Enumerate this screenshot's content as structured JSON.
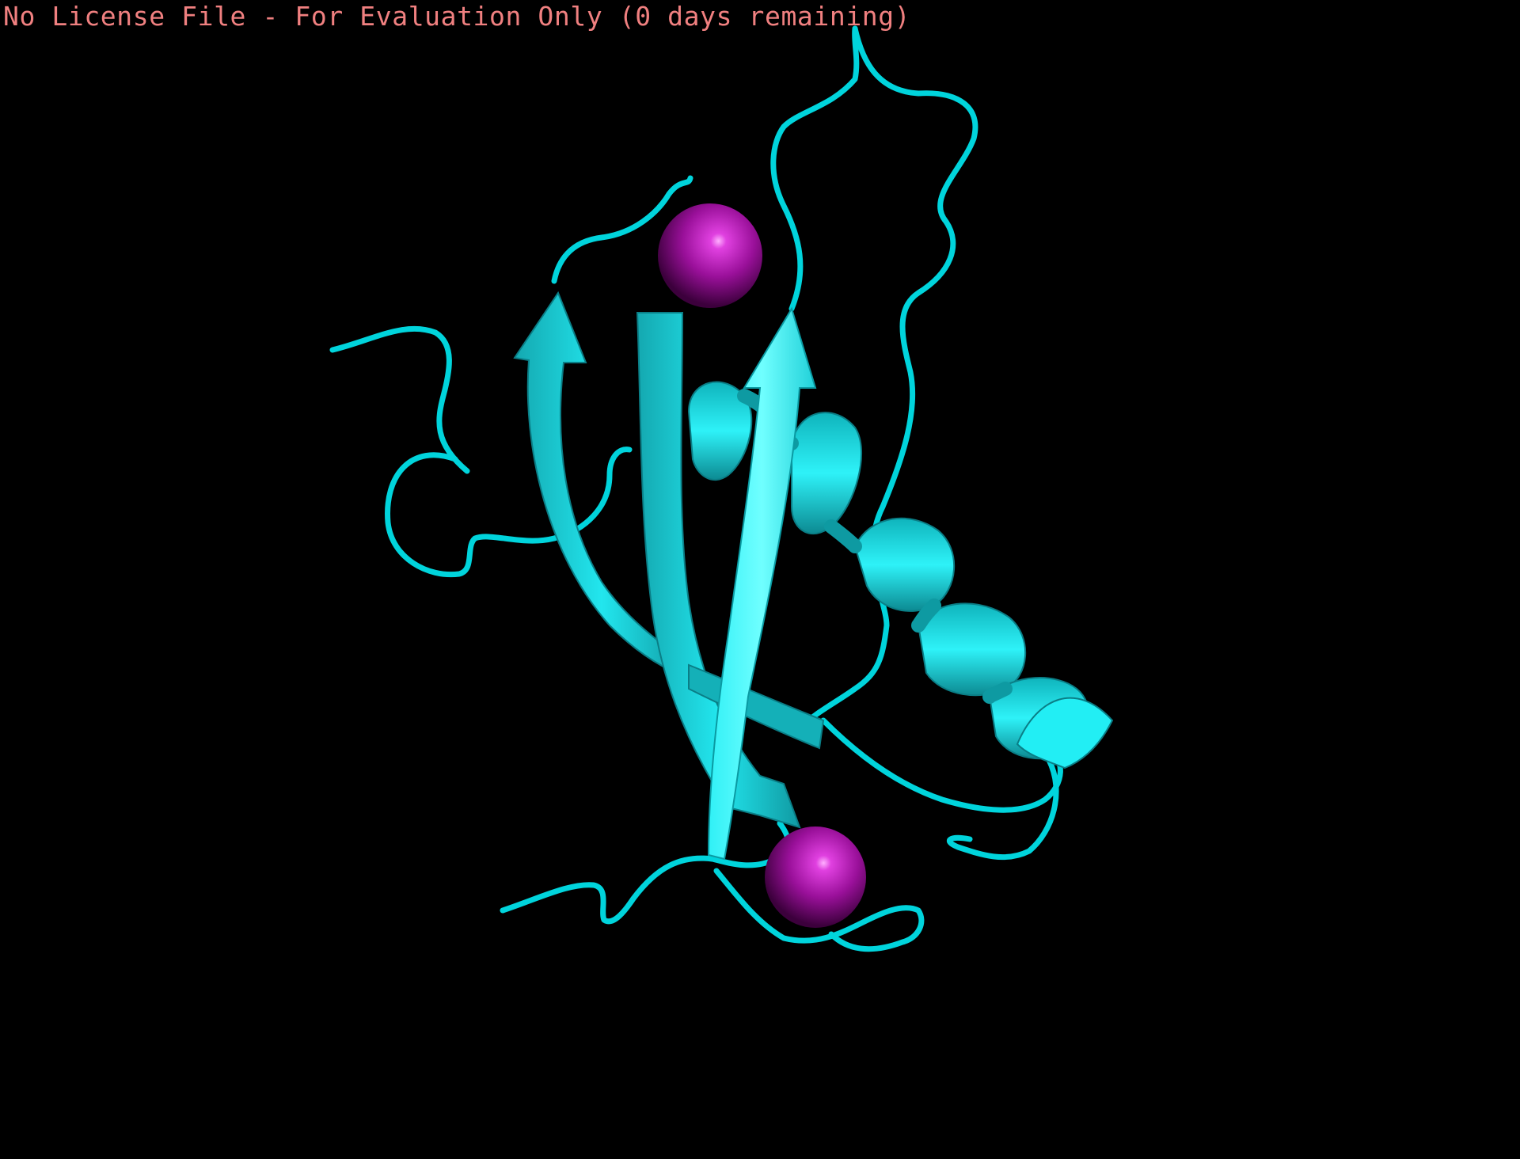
{
  "banner": {
    "text": "No License File - For Evaluation Only (0 days remaining)",
    "color": "#f08080"
  },
  "viewer": {
    "background": "#000000",
    "cartoon_color": "#00ffff",
    "sphere_color": "#a010a0",
    "representation": "cartoon",
    "ions_shown": 2
  }
}
